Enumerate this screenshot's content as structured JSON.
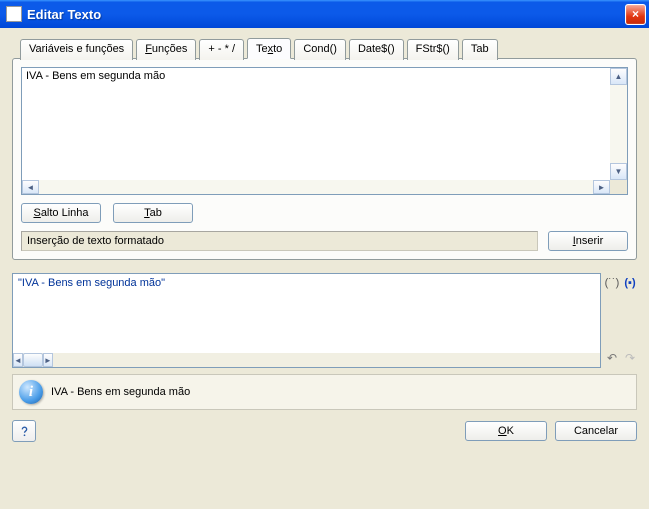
{
  "titlebar": {
    "title": "Editar Texto"
  },
  "tabs": [
    {
      "label": "Variáveis e funções"
    },
    {
      "label": "Funções"
    },
    {
      "label": "+ - * /"
    },
    {
      "label": "Texto"
    },
    {
      "label": "Cond()"
    },
    {
      "label": "Date$()"
    },
    {
      "label": "FStr$()"
    },
    {
      "label": "Tab"
    }
  ],
  "active_tab_index": 3,
  "text_area": {
    "value": "IVA - Bens em segunda mão"
  },
  "buttons": {
    "salto_linha": "Salto Linha",
    "tab": "Tab",
    "inserir": "Inserir",
    "ok": "OK",
    "cancelar": "Cancelar"
  },
  "status_text": "Inserção de texto formatado",
  "expression": {
    "value": "\"IVA - Bens em segunda mão\""
  },
  "info_text": "IVA - Bens em segunda mão",
  "icons": {
    "close": "×",
    "bracket": "(˙˙)",
    "paren_fill": "(▪)",
    "undo": "↶",
    "redo": "↷"
  }
}
